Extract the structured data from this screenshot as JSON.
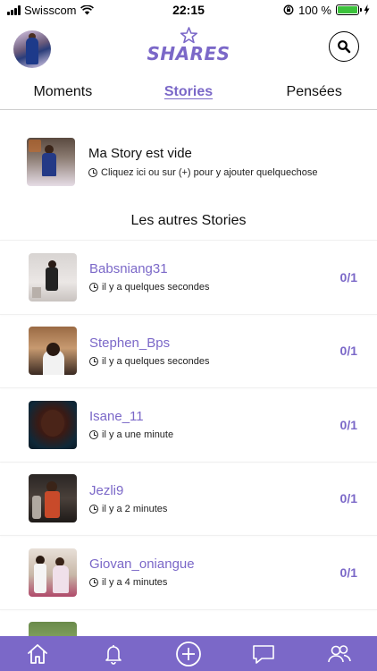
{
  "status_bar": {
    "carrier": "Swisscom",
    "time": "22:15",
    "battery_percent": "100 %"
  },
  "header": {
    "logo_text": "SHARES",
    "icons": [
      "user-avatar",
      "star-icon",
      "search-icon"
    ]
  },
  "tabs": [
    {
      "label": "Moments",
      "active": false
    },
    {
      "label": "Stories",
      "active": true
    },
    {
      "label": "Pensées",
      "active": false
    }
  ],
  "my_story": {
    "title": "Ma Story est vide",
    "hint": "Cliquez ici ou sur (+) pour y ajouter quelquechose"
  },
  "others_title": "Les autres Stories",
  "stories": [
    {
      "name": "Babsniang31",
      "time": "il y a quelques secondes",
      "count": "0/1"
    },
    {
      "name": "Stephen_Bps",
      "time": "il y a quelques secondes",
      "count": "0/1"
    },
    {
      "name": "Isane_11",
      "time": "il y a une minute",
      "count": "0/1"
    },
    {
      "name": "Jezli9",
      "time": "il y a 2 minutes",
      "count": "0/1"
    },
    {
      "name": "Giovan_oniangue",
      "time": "il y a 4 minutes",
      "count": "0/1"
    }
  ],
  "bottom_nav": [
    "home-icon",
    "bell-icon",
    "add-icon",
    "chat-icon",
    "users-icon"
  ],
  "colors": {
    "accent": "#7b68c8",
    "battery": "#3cc23c"
  }
}
